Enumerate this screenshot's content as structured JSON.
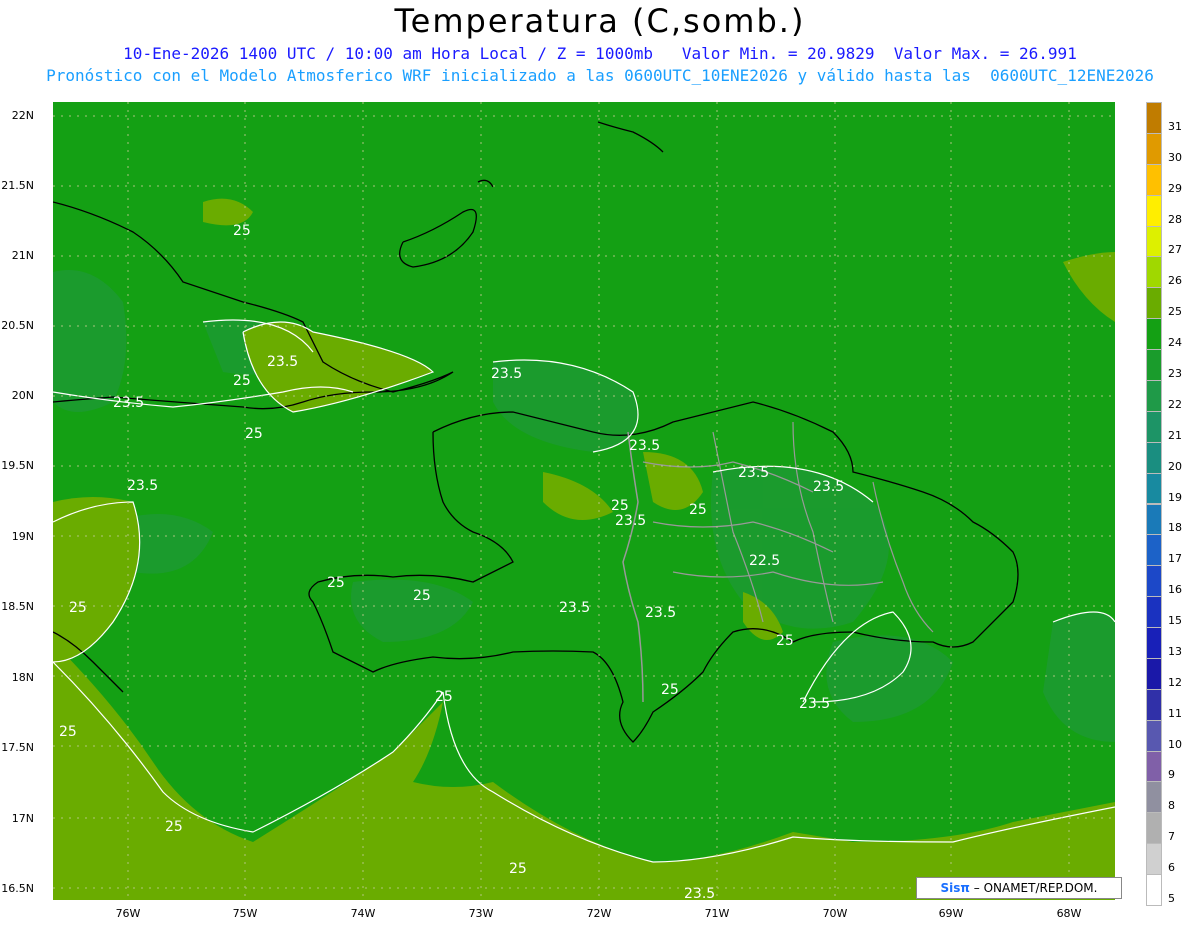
{
  "title": "Temperatura (C,somb.)",
  "subtitle_line1": "10-Ene-2026 1400 UTC / 10:00 am Hora Local / Z = 1000mb   Valor Min. = 20.9829  Valor Max. = 26.991",
  "subtitle_line2": "Pronóstico con el Modelo Atmosferico WRF inicializado a las 0600UTC_10ENE2026 y válido hasta las  0600UTC_12ENE2026",
  "lat_labels": [
    "22N",
    "21.5N",
    "21N",
    "20.5N",
    "20N",
    "19.5N",
    "19N",
    "18.5N",
    "18N",
    "17.5N",
    "17N",
    "16.5N"
  ],
  "lon_labels": [
    "76W",
    "75W",
    "74W",
    "73W",
    "72W",
    "71W",
    "70W",
    "69W",
    "68W"
  ],
  "contour_labels": [
    "25",
    "23.5",
    "25",
    "23.5",
    "25",
    "23.5",
    "25",
    "23.5",
    "23.5",
    "25",
    "23.5",
    "25",
    "25",
    "23.5",
    "22.5",
    "23.5",
    "25",
    "23.5",
    "23.5",
    "25",
    "25",
    "23.5",
    "25",
    "25",
    "25",
    "25",
    "23.5"
  ],
  "colorbar": {
    "labels": [
      "31",
      "30",
      "29",
      "28",
      "27",
      "26",
      "25",
      "24",
      "23",
      "22",
      "21",
      "20",
      "19",
      "18",
      "17",
      "16",
      "15",
      "13",
      "12",
      "11",
      "10",
      "9",
      "8",
      "7",
      "6",
      "5"
    ],
    "colors": [
      "#c07c00",
      "#e09a00",
      "#ffc000",
      "#ffee00",
      "#ddf000",
      "#a0d800",
      "#6aac00",
      "#14a014",
      "#1a9c2c",
      "#1f9a48",
      "#1d9466",
      "#1a8e80",
      "#188aa0",
      "#1a7ab8",
      "#1c62c8",
      "#1c48c8",
      "#1a32c0",
      "#1820b8",
      "#1a18a8",
      "#3030a8",
      "#5858b0",
      "#8060a8",
      "#9090a0",
      "#b0b0b0",
      "#d0d0d0",
      "#ffffff"
    ]
  },
  "credit": {
    "logo": "Sisπ",
    "text": "– ONAMET/REP.DOM."
  }
}
